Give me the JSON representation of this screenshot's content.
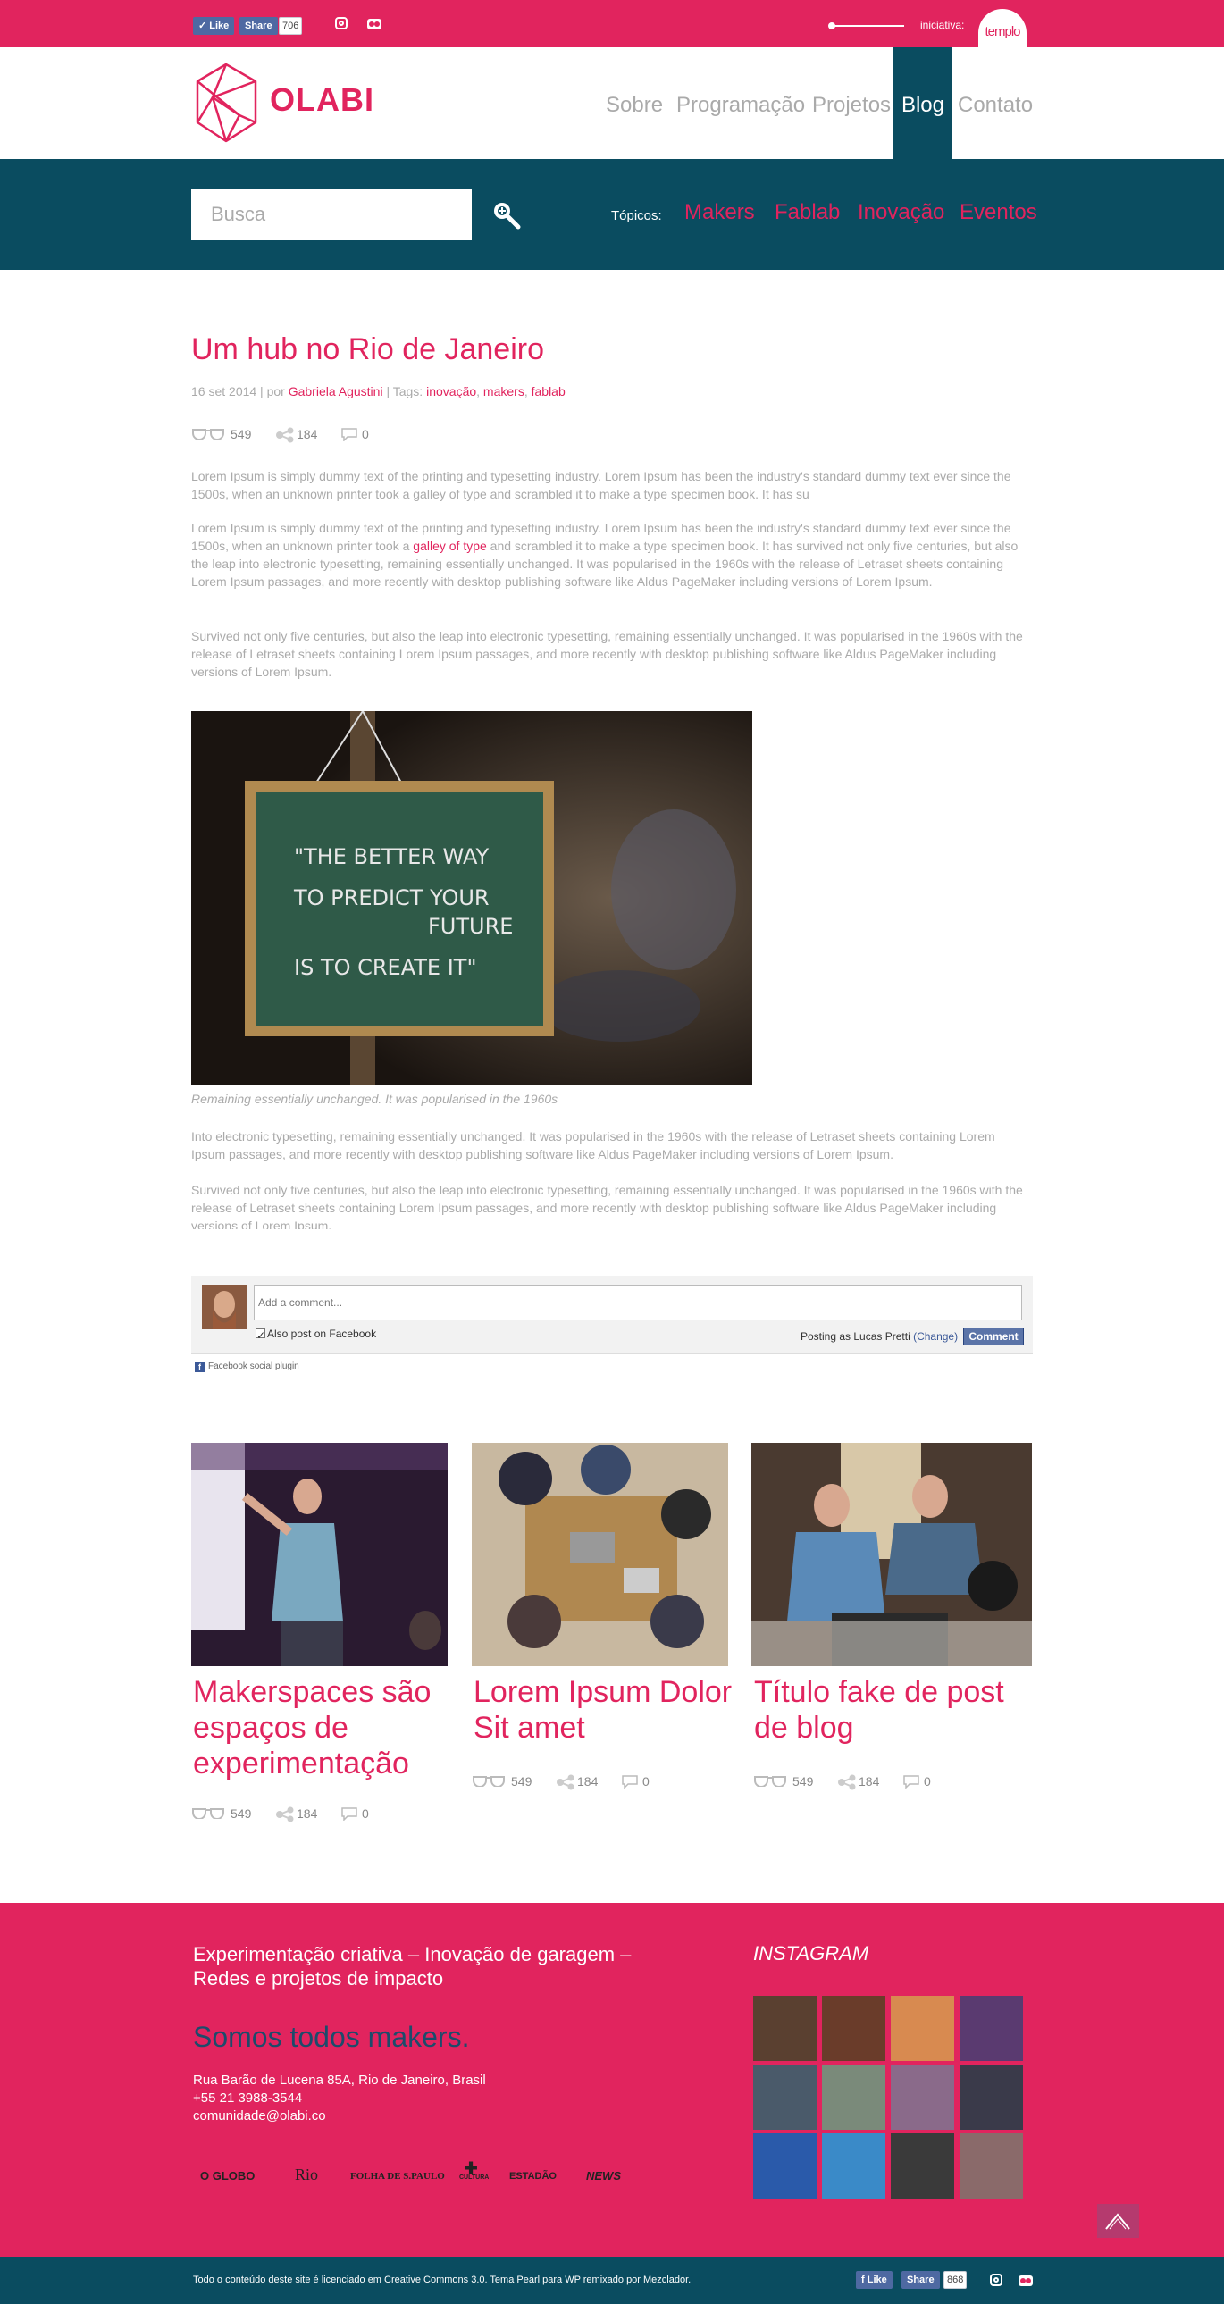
{
  "topbar": {
    "like_label": "Like",
    "share_label": "Share",
    "share_count": "706",
    "iniciativa_label": "iniciativa:",
    "templo_label": "templo",
    "social_icons": [
      "instagram-icon",
      "flickr-icon"
    ]
  },
  "header": {
    "logo_text": "OLABI",
    "nav": [
      "Sobre",
      "Programação",
      "Projetos",
      "Blog",
      "Contato"
    ],
    "active_nav": "Blog"
  },
  "search": {
    "placeholder": "Busca",
    "topics_label": "Tópicos:",
    "topics": [
      "Makers",
      "Fablab",
      "Inovação",
      "Eventos"
    ]
  },
  "article": {
    "title": "Um hub no Rio de Janeiro",
    "date": "16 set 2014",
    "by_label": "por",
    "author": "Gabriela Agustini",
    "tags_label": "Tags:",
    "tags": [
      "inovação",
      "makers",
      "fablab"
    ],
    "views": "549",
    "shares": "184",
    "comments": "0",
    "p1": "Lorem Ipsum is simply dummy text of the printing and typesetting industry. Lorem Ipsum has been the industry's standard dummy text ever since the 1500s, when an unknown printer took a galley of type and scrambled it to make a type specimen book. It has su",
    "p2_before": "Lorem Ipsum is simply dummy text of the printing and typesetting industry. Lorem Ipsum has been the industry's standard dummy text ever since the 1500s, when an unknown printer took a ",
    "p2_link": "galley of type",
    "p2_after": " and scrambled it to make a type specimen book. It has survived not only five centuries, but also the leap into electronic typesetting, remaining essentially unchanged. It was popularised in the 1960s with the release of Letraset sheets containing Lorem Ipsum passages, and more recently with desktop publishing software like Aldus PageMaker including versions of Lorem Ipsum.",
    "p3": "Survived not only five centuries, but also the leap into electronic typesetting, remaining essentially unchanged. It was popularised in the 1960s with the release of Letraset sheets containing Lorem Ipsum passages, and more recently with desktop publishing software like Aldus PageMaker including versions of Lorem Ipsum.",
    "image_quote_lines": [
      "\"THE BETTER WAY",
      "TO PREDICT YOUR",
      "FUTURE",
      "IS TO CREATE IT\""
    ],
    "caption": "Remaining essentially unchanged. It was popularised in the 1960s",
    "p4": "Into electronic typesetting, remaining essentially unchanged. It was popularised in the 1960s with the release of Letraset sheets containing Lorem Ipsum passages, and more recently with desktop publishing software like Aldus PageMaker including versions of Lorem Ipsum.",
    "p5": "Survived not only five centuries, but also the leap into electronic typesetting, remaining essentially unchanged. It was popularised in the 1960s with the release of Letraset sheets containing Lorem Ipsum passages, and more recently with desktop publishing software like Aldus PageMaker including versions of Lorem Ipsum."
  },
  "comments": {
    "placeholder": "Add a comment...",
    "also_post": "Also post on Facebook",
    "posting_as": "Posting as Lucas Pretti",
    "change": "(Change)",
    "button": "Comment",
    "plugin_label": "Facebook social plugin"
  },
  "related": [
    {
      "title": "Makerspaces são espaços de experimentação",
      "views": "549",
      "shares": "184",
      "comments": "0"
    },
    {
      "title": "Lorem Ipsum Dolor Sit amet",
      "views": "549",
      "shares": "184",
      "comments": "0"
    },
    {
      "title": "Título fake de post de blog",
      "views": "549",
      "shares": "184",
      "comments": "0"
    }
  ],
  "footer": {
    "tagline": "Experimentação criativa – Inovação de garagem – Redes e projetos de impacto",
    "makers": "Somos todos makers.",
    "address": "Rua Barão de Lucena 85A, Rio de Janeiro, Brasil",
    "phone": "+55 21 3988-3544",
    "email": "comunidade@olabi.co",
    "partners": [
      "O GLOBO",
      "Rio",
      "FOLHA DE S.PAULO",
      "CULTURA",
      "ESTADÃO",
      "NEWS"
    ],
    "instagram_title": "INSTAGRAM",
    "instagram_colors": [
      "#5a4030",
      "#6a3c2a",
      "#d88a50",
      "#5a3a70",
      "#4a5a6a",
      "#7a8a7a",
      "#8a6a8a",
      "#3a3a4a",
      "#2a5aaa",
      "#3a8ac8",
      "#3a3a3a",
      "#8a6a6a"
    ]
  },
  "bottombar": {
    "license": "Todo o conteúdo deste site é licenciado em Creative Commons 3.0. Tema Pearl para WP remixado por Mezclador.",
    "like_label": "Like",
    "share_label": "Share",
    "share_count": "868"
  },
  "colors": {
    "brand_pink": "#e1245e",
    "teal": "#0a4c60",
    "navy_text": "#1c4b6b"
  }
}
